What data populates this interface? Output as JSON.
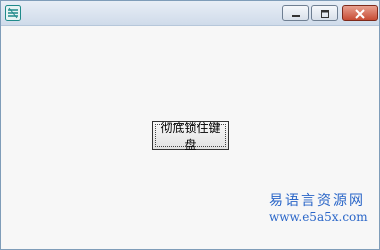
{
  "window": {
    "title": "",
    "app_icon": "app-logo-icon",
    "controls": {
      "minimize_icon": "minimize-icon",
      "maximize_icon": "maximize-icon",
      "close_icon": "close-icon"
    }
  },
  "main": {
    "button_label": "彻底锁住键盘"
  },
  "watermark": {
    "site_name": "易语言资源网",
    "url": "www.e5a5x.com"
  },
  "colors": {
    "titlebar": "#dbe4ef",
    "close_button": "#c74c34",
    "client_background": "#f7f7f7",
    "watermark": "#2a66c8"
  }
}
